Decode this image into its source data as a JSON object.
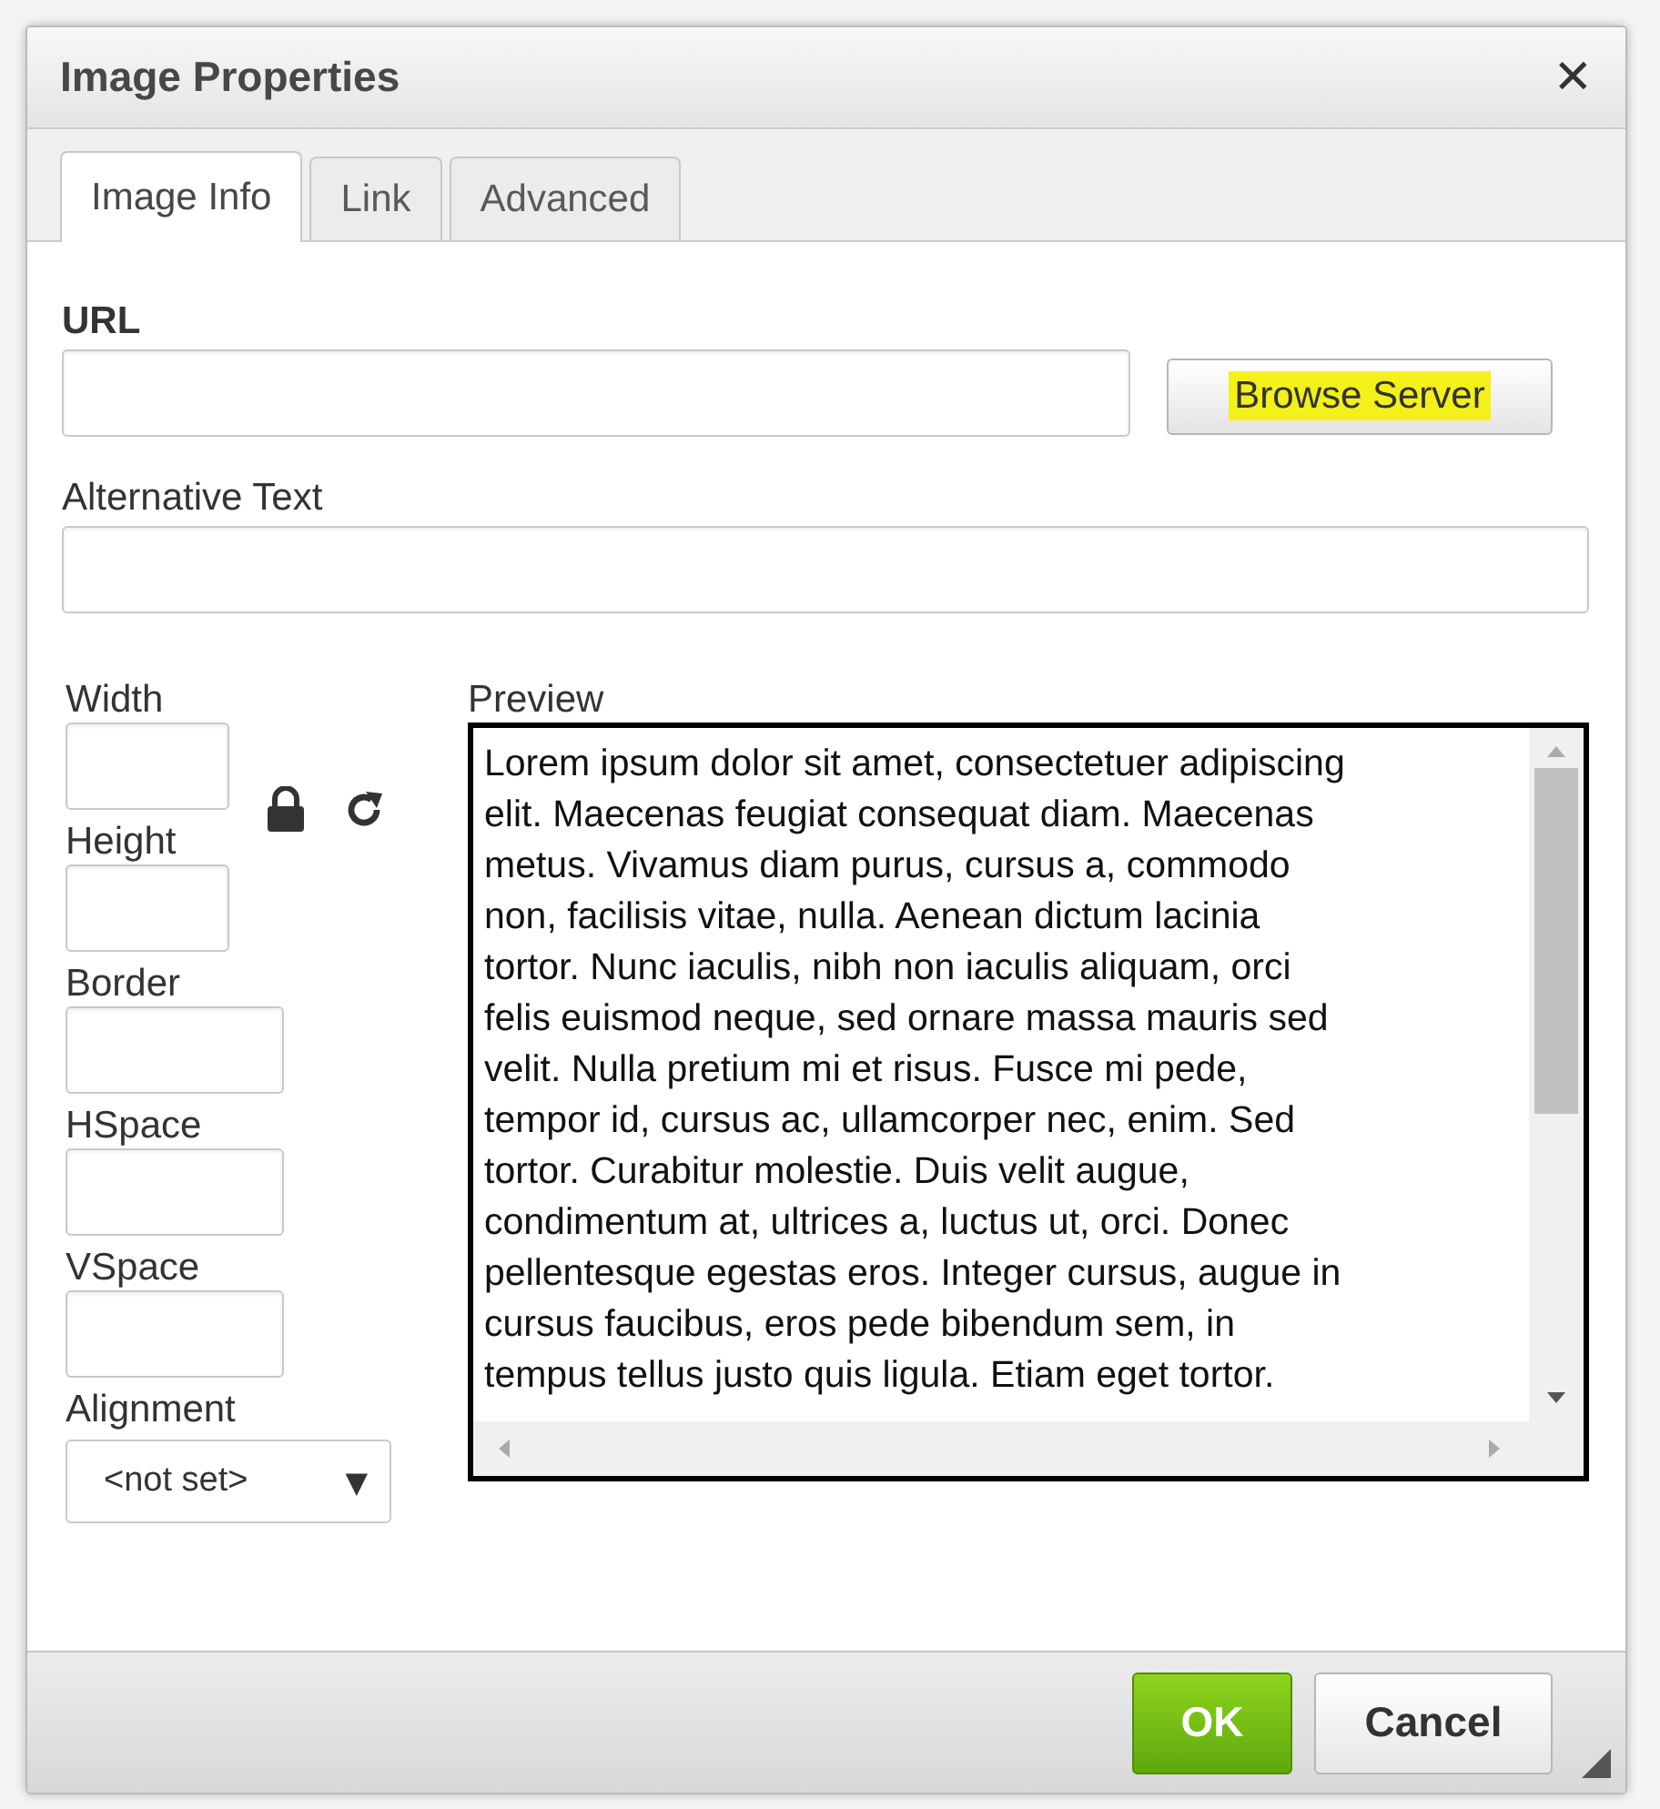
{
  "window": {
    "title": "Image Properties",
    "close_glyph": "✕"
  },
  "tabs": [
    {
      "label": "Image Info",
      "selected": true
    },
    {
      "label": "Link",
      "selected": false
    },
    {
      "label": "Advanced",
      "selected": false
    }
  ],
  "url": {
    "label": "URL"
  },
  "browse_button": {
    "label": "Browse Server",
    "highlighted": true
  },
  "alt_text": {
    "label": "Alternative Text"
  },
  "size_fields": [
    {
      "label": "Width"
    },
    {
      "label": "Height"
    }
  ],
  "spacing_fields": [
    {
      "label": "Border"
    },
    {
      "label": "HSpace"
    },
    {
      "label": "VSpace"
    }
  ],
  "alignment": {
    "label": "Alignment",
    "value": "<not set>",
    "arrow": "▼"
  },
  "preview": {
    "label": "Preview",
    "lines": [
      "Lorem ipsum dolor sit amet, consectetuer adipiscing",
      "elit. Maecenas feugiat consequat diam. Maecenas",
      "metus. Vivamus diam purus, cursus a, commodo",
      "non, facilisis vitae, nulla. Aenean dictum lacinia",
      "tortor. Nunc iaculis, nibh non iaculis aliquam, orci",
      "felis euismod neque, sed ornare massa mauris sed",
      "velit. Nulla pretium mi et risus. Fusce mi pede,",
      "tempor id, cursus ac, ullamcorper nec, enim. Sed",
      "tortor. Curabitur molestie. Duis velit augue,",
      "condimentum at, ultrices a, luctus ut, orci. Donec",
      "pellentesque egestas eros. Integer cursus, augue in",
      "cursus faucibus, eros pede bibendum sem, in",
      "tempus tellus justo quis ligula. Etiam eget tortor."
    ]
  },
  "buttons": [
    {
      "label": "OK",
      "kind": "primary"
    },
    {
      "label": "Cancel",
      "kind": "secondary"
    }
  ]
}
